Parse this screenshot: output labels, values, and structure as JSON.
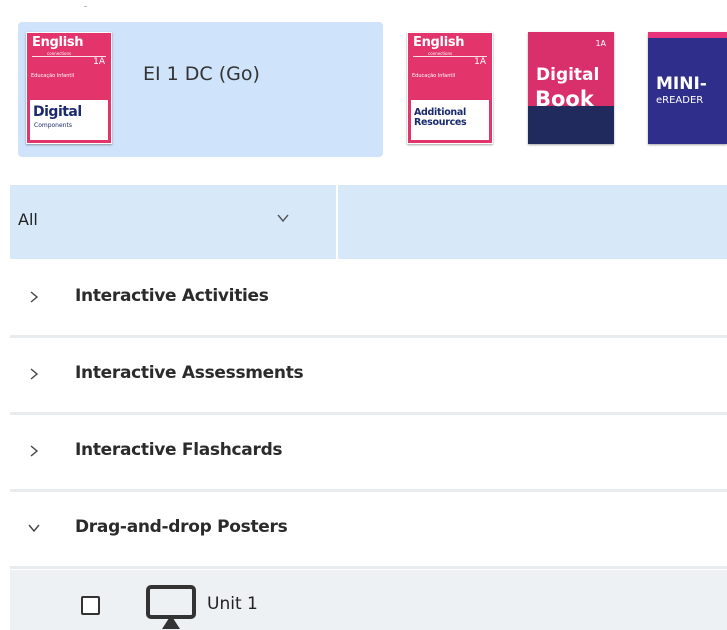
{
  "selected_product": {
    "title": "EI 1 DC (Go)",
    "cover": {
      "brand": "English",
      "sub": "connections",
      "level": "1A",
      "edu": "Educação Infantil",
      "panel_big": "Digital",
      "panel_small": "Components"
    }
  },
  "products": [
    {
      "type": "english",
      "brand": "English",
      "sub": "connections",
      "level": "1A",
      "edu": "Educação Infantil",
      "panel_line1": "Additional",
      "panel_line2": "Resources"
    },
    {
      "type": "digital-book",
      "level": "1A",
      "line1": "Digital",
      "line2": "Book"
    },
    {
      "type": "mini-ereader",
      "line1": "MINI-",
      "line2": "eREADER"
    }
  ],
  "filter": {
    "selected": "All"
  },
  "sections": [
    {
      "label": "Interactive Activities",
      "expanded": false
    },
    {
      "label": "Interactive Assessments",
      "expanded": false
    },
    {
      "label": "Interactive Flashcards",
      "expanded": false
    },
    {
      "label": "Drag-and-drop Posters",
      "expanded": true
    }
  ],
  "items": [
    {
      "label": "Unit 1",
      "icon": "monitor-icon",
      "checked": false
    }
  ],
  "colors": {
    "selected_bg": "#cfe3fa",
    "filter_bg": "#d7e8f9",
    "item_bg": "#eef1f3",
    "cover_pink": "#e3356b",
    "cover_navy": "#202a5c",
    "cover_purple": "#2f2e8a"
  }
}
